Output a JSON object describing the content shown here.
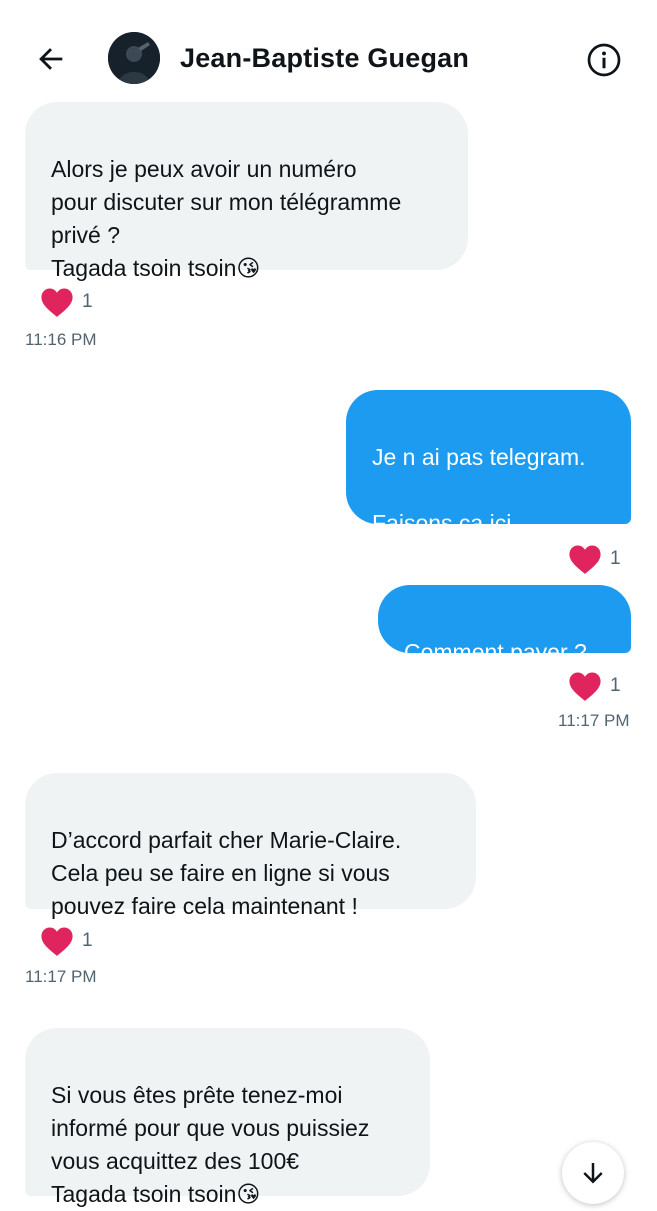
{
  "header": {
    "contact_name": "Jean-Baptiste Guegan",
    "back_icon": "arrow-left-icon",
    "info_icon": "info-icon",
    "avatar_icon": "avatar"
  },
  "messages": [
    {
      "direction": "in",
      "text": "Alors je peux avoir un numéro\npour discuter sur mon télégramme\nprivé ?\nTagada tsoin tsoin😘",
      "reaction": {
        "icon": "heart-icon",
        "count": "1"
      },
      "time": "11:16 PM"
    },
    {
      "direction": "out",
      "text": "Je n ai pas telegram.\n\nFaisons ça ici",
      "reaction": {
        "icon": "heart-icon",
        "count": "1"
      }
    },
    {
      "direction": "out",
      "text": "Comment payer ?",
      "reaction": {
        "icon": "heart-icon",
        "count": "1"
      },
      "time": "11:17 PM"
    },
    {
      "direction": "in",
      "text": "D’accord parfait cher Marie-Claire.\nCela peu se faire en ligne si vous\npouvez faire cela maintenant !",
      "reaction": {
        "icon": "heart-icon",
        "count": "1"
      },
      "time": "11:17 PM"
    },
    {
      "direction": "in",
      "text": "Si vous êtes prête tenez-moi\ninformé pour que vous puissiez\nvous acquittez des 100€\nTagada tsoin tsoin😘"
    }
  ],
  "scroll_down_icon": "arrow-down-icon",
  "colors": {
    "outgoing_bubble": "#1d9bf0",
    "incoming_bubble": "#eff3f4",
    "heart": "#e0245e",
    "meta_text": "#536471"
  }
}
